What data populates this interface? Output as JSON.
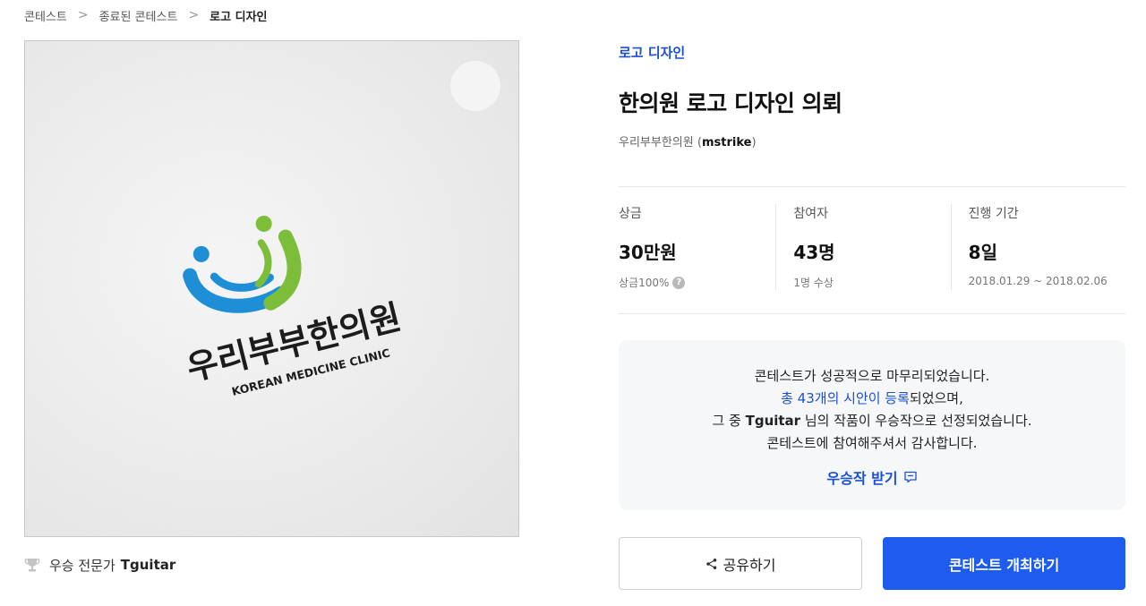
{
  "breadcrumb": {
    "items": [
      "콘테스트",
      "종료된 콘테스트",
      "로고 디자인"
    ],
    "separator": ">"
  },
  "image": {
    "logo_text_ko": "우리부부한의원",
    "logo_text_en": "KOREAN MEDICINE CLINIC",
    "colors": {
      "blue": "#1e8fd6",
      "green": "#7cbd3a"
    }
  },
  "winner": {
    "prefix": "우승 전문가",
    "name": "Tguitar",
    "icon": "trophy-icon"
  },
  "contest": {
    "category": "로고 디자인",
    "title": "한의원 로고 디자인 의뢰",
    "host_name": "우리부부한의원",
    "host_open": " (",
    "host_id": "mstrike",
    "host_close": ")"
  },
  "stats": {
    "prize": {
      "label": "상금",
      "value": "30만원",
      "sub": "상금100%",
      "help": "?"
    },
    "participants": {
      "label": "참여자",
      "value": "43명",
      "sub": "1명 수상"
    },
    "period": {
      "label": "진행 기간",
      "value": "8일",
      "sub": "2018.01.29 ~ 2018.02.06"
    }
  },
  "notice": {
    "line1": "콘테스트가 성공적으로 마무리되었습니다.",
    "line2_highlight": "총 43개의 시안이 등록",
    "line2_rest": "되었으며,",
    "line3_pre": "그 중 ",
    "line3_name": "Tguitar",
    "line3_post": " 님의 작품이 우승작으로 선정되었습니다.",
    "line4": "콘테스트에 참여해주셔서 감사합니다.",
    "cta": "우승작 받기"
  },
  "actions": {
    "share": "공유하기",
    "host": "콘테스트 개최하기"
  },
  "colors": {
    "accent": "#1a4fd6",
    "primary_button": "#1e5cf0",
    "notice_bg": "#f6f7f9"
  }
}
